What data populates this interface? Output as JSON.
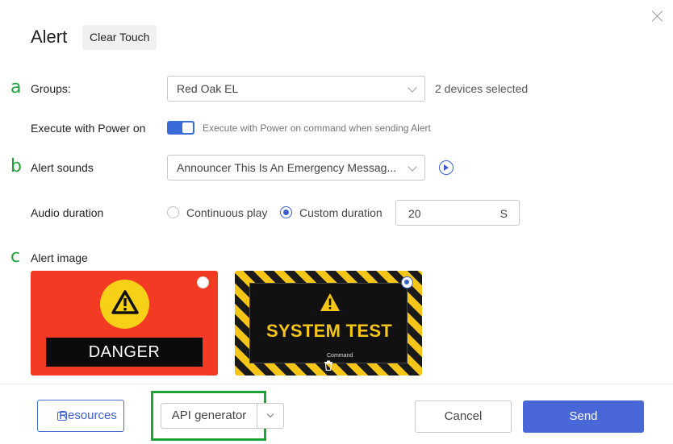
{
  "dialog": {
    "title": "Alert",
    "clear_touch_label": "Clear Touch"
  },
  "markers": {
    "a": "a",
    "b": "b",
    "c": "c"
  },
  "groups": {
    "label": "Groups:",
    "selected": "Red Oak EL",
    "devices_selected": "2 devices selected"
  },
  "power_on": {
    "label": "Execute with Power on",
    "enabled": true,
    "description": "Execute with Power on command when sending Alert"
  },
  "alert_sounds": {
    "label": "Alert sounds",
    "selected": "Announcer This Is An Emergency Messag..."
  },
  "audio_duration": {
    "label": "Audio duration",
    "continuous_label": "Continuous play",
    "custom_label": "Custom duration",
    "selected": "custom",
    "value": "20",
    "unit": "S"
  },
  "alert_image": {
    "label": "Alert image",
    "danger_text": "DANGER",
    "system_test_text": "SYSTEM TEST",
    "command_caption": "Command",
    "selected": "system-test"
  },
  "footer": {
    "resources_label": "Resources",
    "api_generator_label": "API generator",
    "cancel_label": "Cancel",
    "send_label": "Send"
  },
  "colors": {
    "accent": "#4a67d8",
    "annotation_green": "#1fa33a",
    "danger_red": "#f23b22",
    "warning_yellow": "#f5c518"
  }
}
